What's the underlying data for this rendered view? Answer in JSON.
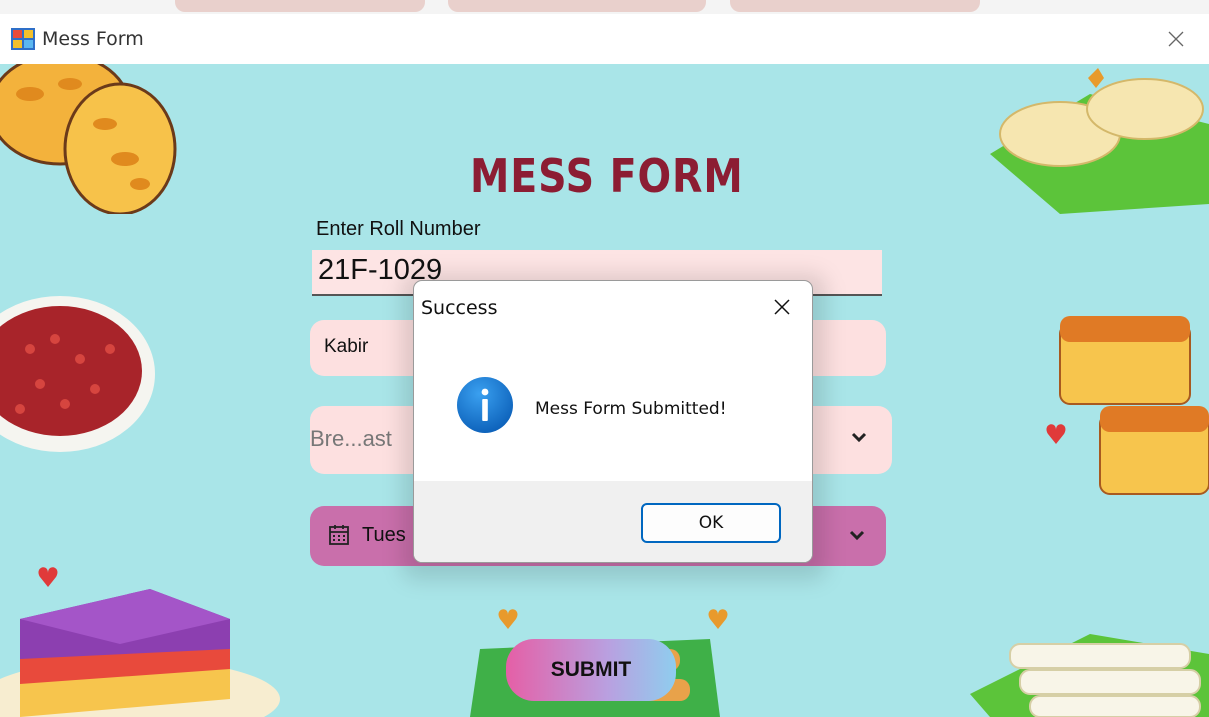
{
  "window": {
    "title": "Mess Form",
    "icon": "windows-forms-app-icon",
    "close_icon": "close-icon"
  },
  "form": {
    "heading": "MESS FORM",
    "roll_label": "Enter Roll Number",
    "roll_value": "21F-1029",
    "name_value": "Kabir",
    "meal_value": "Bre...ast",
    "date_value": "Tues",
    "submit_label": "SUBMIT",
    "colors": {
      "background": "#a9e5e8",
      "heading": "#8c1d33",
      "field_pink": "#fde0e0",
      "date_field": "#c96fab"
    }
  },
  "dialog": {
    "title": "Success",
    "message": "Mess Form Submitted!",
    "ok_label": "OK",
    "icon": "info-icon",
    "accent": "#0067c0"
  }
}
